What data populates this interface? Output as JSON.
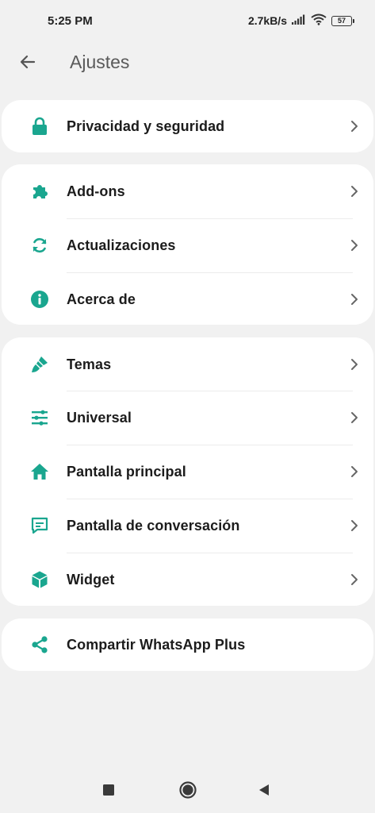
{
  "status_bar": {
    "time": "5:25 PM",
    "network_speed": "2.7kB/s",
    "battery_level": "57",
    "icons": [
      "signal-icon",
      "wifi-icon",
      "battery-icon"
    ]
  },
  "app_bar": {
    "title": "Ajustes",
    "back_icon": "arrow-back-icon"
  },
  "accent_color": "#1aa68f",
  "groups": [
    {
      "items": [
        {
          "label": "Privacidad y seguridad",
          "icon": "lock-icon"
        }
      ]
    },
    {
      "items": [
        {
          "label": "Add-ons",
          "icon": "puzzle-icon"
        },
        {
          "label": "Actualizaciones",
          "icon": "sync-icon"
        },
        {
          "label": "Acerca de",
          "icon": "info-icon"
        }
      ]
    },
    {
      "items": [
        {
          "label": "Temas",
          "icon": "paint-brush-icon"
        },
        {
          "label": "Universal",
          "icon": "sliders-icon"
        },
        {
          "label": "Pantalla principal",
          "icon": "home-icon"
        },
        {
          "label": "Pantalla de conversación",
          "icon": "chat-icon"
        },
        {
          "label": "Widget",
          "icon": "cube-icon"
        }
      ]
    },
    {
      "items": [
        {
          "label": "Compartir WhatsApp Plus",
          "icon": "share-icon"
        }
      ]
    }
  ],
  "nav_bar": {
    "buttons": [
      "recents-square-icon",
      "home-circle-icon",
      "back-triangle-icon"
    ]
  }
}
